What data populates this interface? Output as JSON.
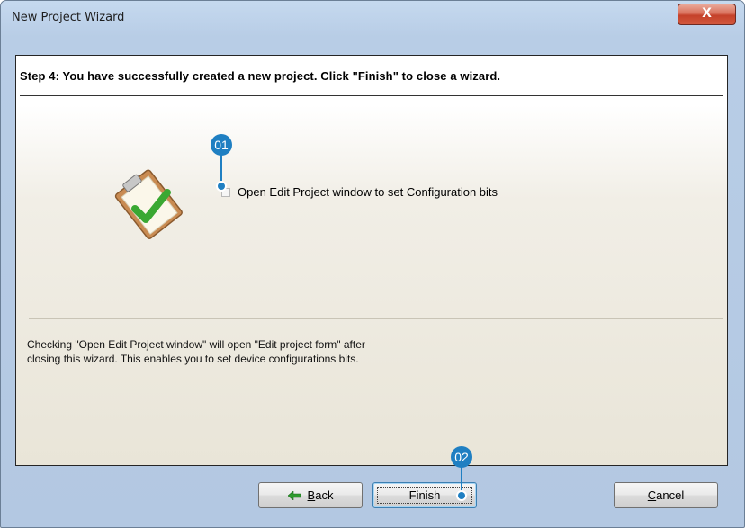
{
  "window": {
    "title": "New Project Wizard",
    "close_glyph": "X"
  },
  "step": {
    "heading": "Step 4: You have successfully created a new project.  Click \"Finish\" to close a wizard."
  },
  "option": {
    "label": "Open Edit Project window to set Configuration bits",
    "checked": false
  },
  "info": {
    "line1": "Checking \"Open Edit Project window\" will open \"Edit project form\" after",
    "line2": "closing this wizard. This enables you to set device configurations bits."
  },
  "buttons": {
    "back": {
      "label_mnemonic": "B",
      "label_rest": "ack"
    },
    "finish": {
      "label": "Finish"
    },
    "cancel": {
      "label_mnemonic": "C",
      "label_rest": "ancel"
    }
  },
  "callouts": {
    "first": "01",
    "second": "02"
  },
  "colors": {
    "callout": "#1f7fc2",
    "checkmark": "#3aa832",
    "close": "#c4412a"
  },
  "icons": {
    "clipboard": "clipboard-check-icon",
    "back": "green-left-arrow-icon"
  }
}
